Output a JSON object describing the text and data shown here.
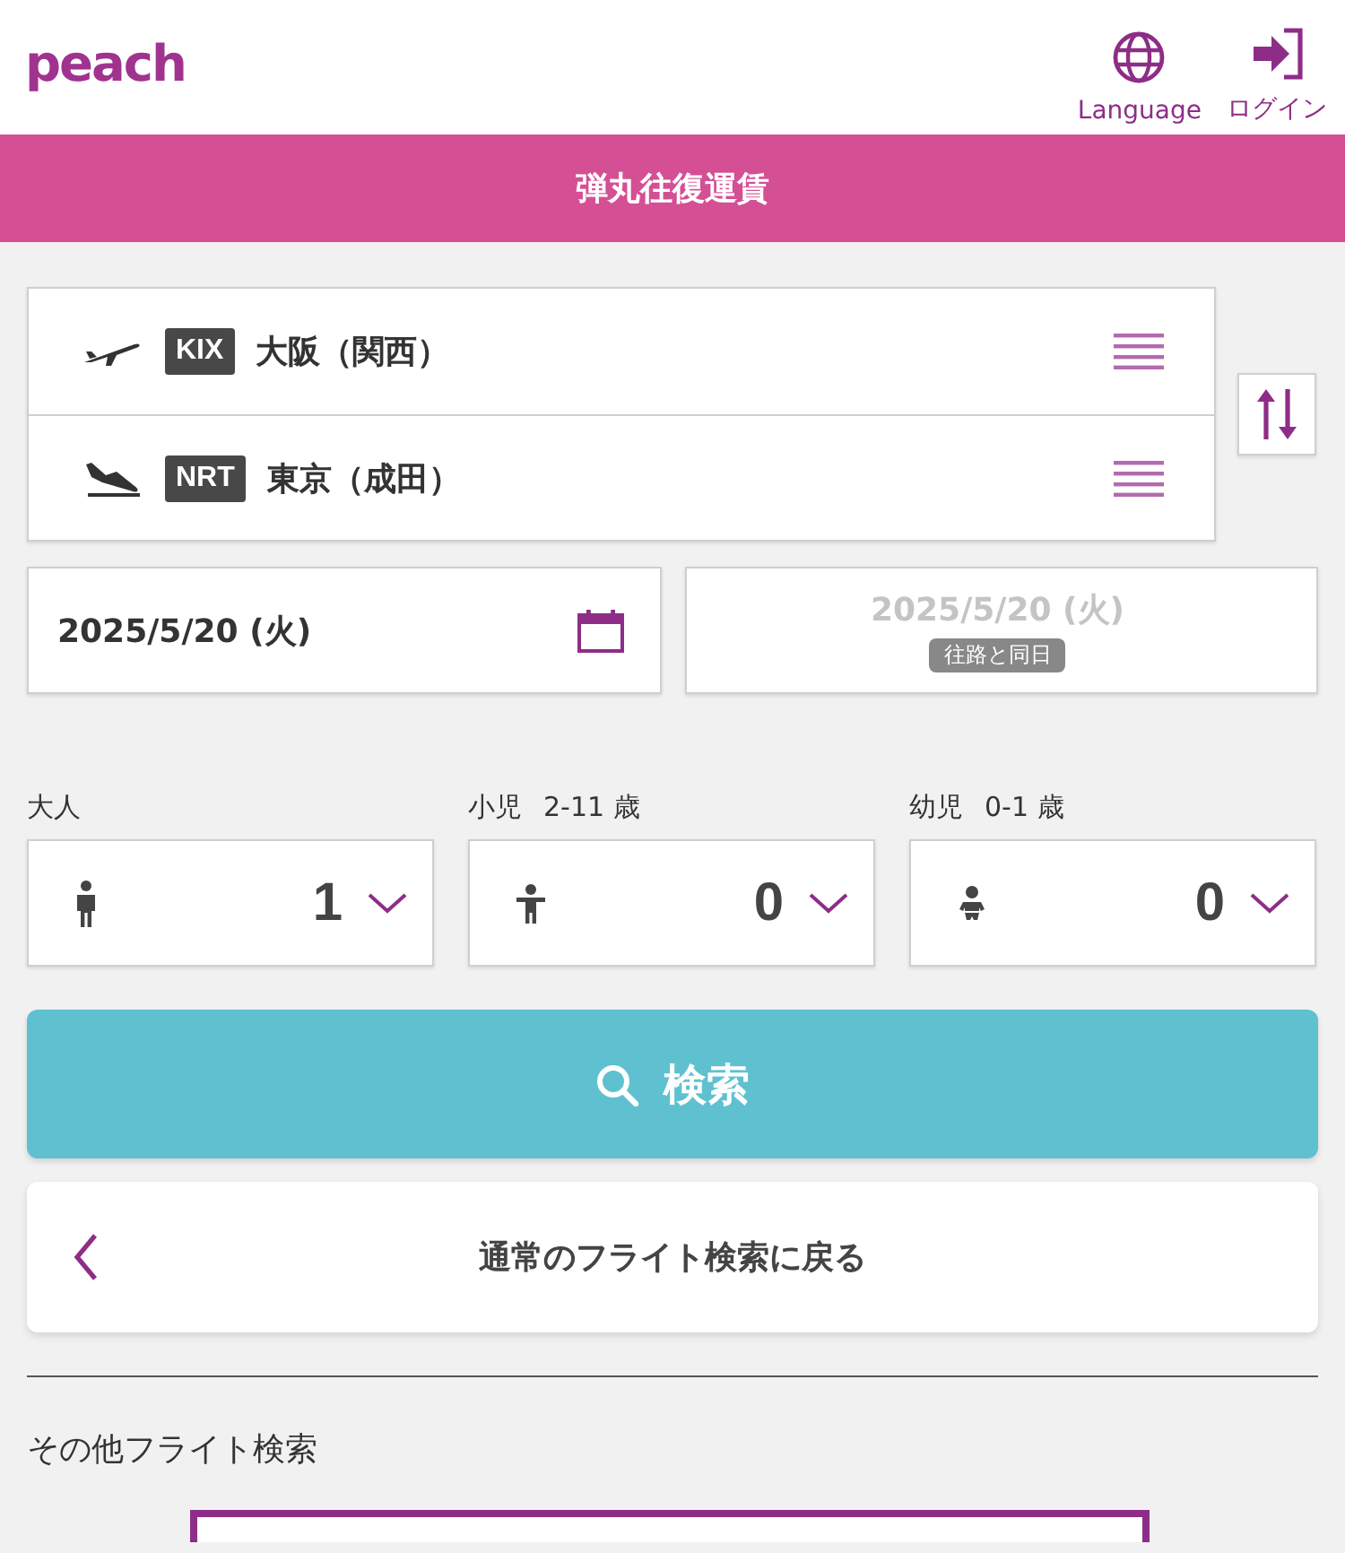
{
  "header": {
    "logo": "peach",
    "actions": [
      {
        "kind": "language",
        "label": "Language"
      },
      {
        "kind": "login",
        "label": "ログイン"
      }
    ]
  },
  "banner": {
    "title": "弾丸往復運賃"
  },
  "route": {
    "legs": [
      {
        "kind": "departure",
        "code": "KIX",
        "city": "大阪（関西）"
      },
      {
        "kind": "arrival",
        "code": "NRT",
        "city": "東京（成田）"
      }
    ]
  },
  "dates": {
    "outbound": {
      "value": "2025/5/20 (火)"
    },
    "return": {
      "value": "2025/5/20 (火)",
      "disabled": true,
      "badge": "往路と同日"
    }
  },
  "passengers": [
    {
      "kind": "adult",
      "label": "大人",
      "count": "1"
    },
    {
      "kind": "child",
      "label": "小児",
      "age": "2-11 歳",
      "count": "0"
    },
    {
      "kind": "infant",
      "label": "幼児",
      "age": "0-1 歳",
      "count": "0"
    }
  ],
  "search_button": {
    "label": "検索"
  },
  "back_button": {
    "label": "通常のフライト検索に戻る"
  },
  "other_section": {
    "title": "その他フライト検索"
  }
}
